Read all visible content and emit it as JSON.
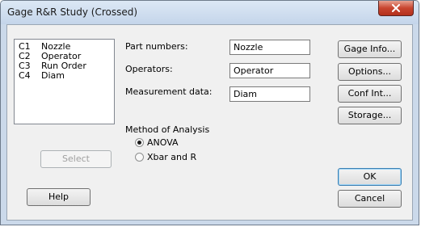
{
  "window": {
    "title": "Gage R&R Study (Crossed)"
  },
  "columns_list": [
    {
      "id": "C1",
      "name": "Nozzle"
    },
    {
      "id": "C2",
      "name": "Operator"
    },
    {
      "id": "C3",
      "name": "Run Order"
    },
    {
      "id": "C4",
      "name": "Diam"
    }
  ],
  "fields": {
    "part_numbers": {
      "label": "Part numbers:",
      "value": "Nozzle"
    },
    "operators": {
      "label": "Operators:",
      "value": "Operator"
    },
    "measurement_data": {
      "label": "Measurement data:",
      "value": "Diam"
    }
  },
  "method": {
    "label": "Method of Analysis",
    "options": [
      {
        "label": "ANOVA",
        "selected": true
      },
      {
        "label": "Xbar and R",
        "selected": false
      }
    ]
  },
  "buttons": {
    "gage_info": "Gage Info...",
    "options": "Options...",
    "conf_int": "Conf Int...",
    "storage": "Storage...",
    "select": "Select",
    "help": "Help",
    "ok": "OK",
    "cancel": "Cancel"
  },
  "colors": {
    "close_button": "#c8452f",
    "frame": "#cbd9ea",
    "client": "#f0f0f0"
  }
}
